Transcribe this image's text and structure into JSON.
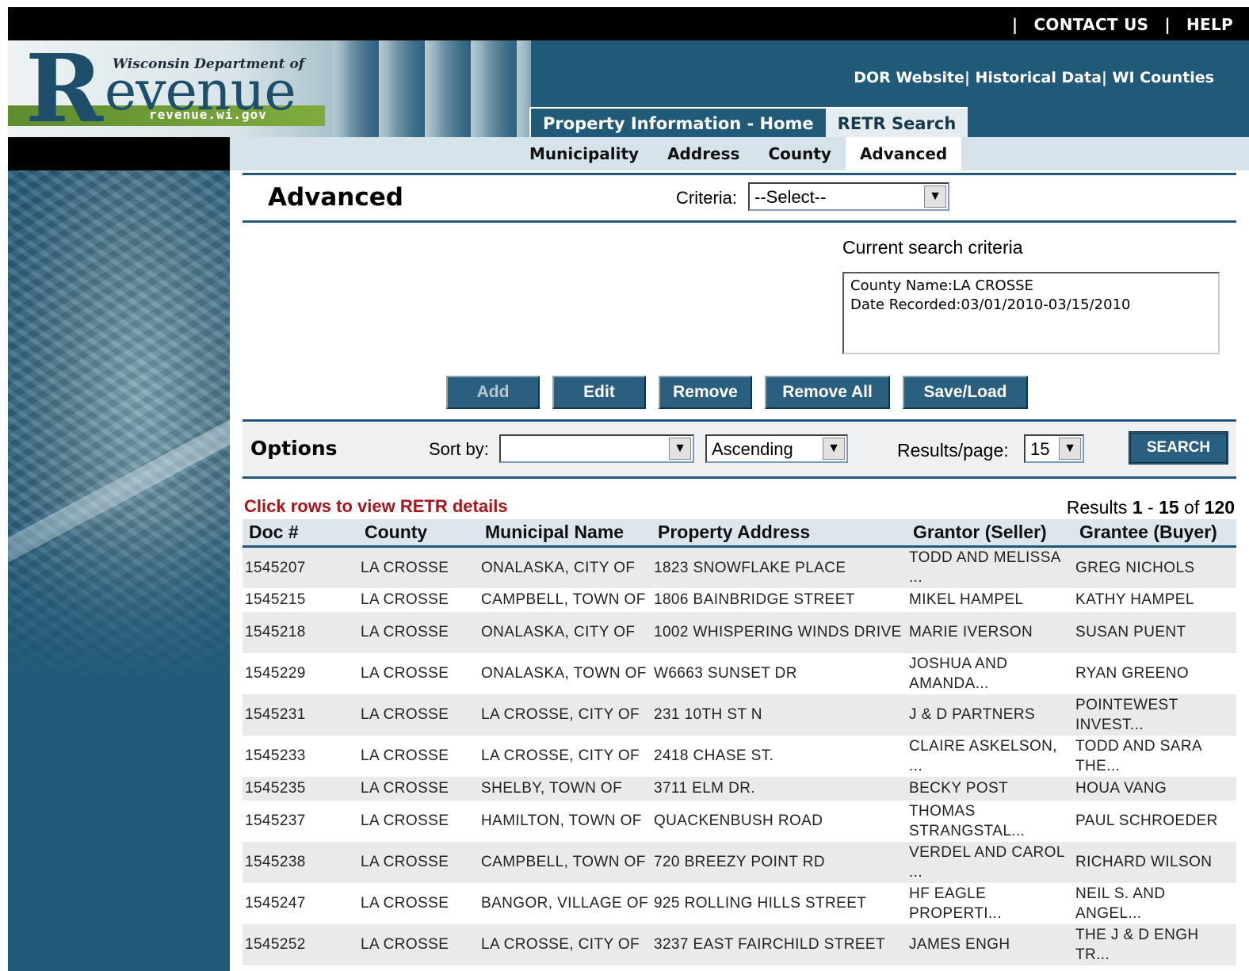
{
  "top_links": {
    "separator": "|",
    "contact": "CONTACT US",
    "help": "HELP"
  },
  "logo": {
    "dept": "Wisconsin Department of",
    "r": "R",
    "word": "evenue",
    "url": "revenue.wi.gov"
  },
  "site_links": "DOR Website| Historical Data| WI Counties",
  "main_tabs": [
    {
      "label": "Property Information - Home"
    },
    {
      "label": "RETR Search"
    }
  ],
  "sub_nav": [
    "Municipality",
    "Address",
    "County",
    "Advanced"
  ],
  "advanced": {
    "title": "Advanced",
    "criteria_label": "Criteria:",
    "criteria_value": "--Select--",
    "current_label": "Current search criteria",
    "current_lines": [
      "County Name:LA CROSSE",
      "Date Recorded:03/01/2010-03/15/2010"
    ]
  },
  "buttons": {
    "add": "Add",
    "edit": "Edit",
    "remove": "Remove",
    "remove_all": "Remove All",
    "save_load": "Save/Load"
  },
  "options": {
    "title": "Options",
    "sort_label": "Sort by:",
    "sort_value": "",
    "order_value": "Ascending",
    "rpp_label": "Results/page:",
    "rpp_value": "15",
    "search_label": "SEARCH"
  },
  "results": {
    "note": "Click rows to view RETR details",
    "prefix": "Results ",
    "from": "1",
    "dash": " - ",
    "to": "15",
    "of": " of ",
    "total": "120"
  },
  "table": {
    "columns": [
      "Doc #",
      "County",
      "Municipal Name",
      "Property Address",
      "Grantor (Seller)",
      "Grantee (Buyer)"
    ],
    "rows": [
      [
        "1545207",
        "LA CROSSE",
        "ONALASKA, CITY OF",
        "1823 SNOWFLAKE PLACE",
        "TODD AND MELISSA ...",
        "GREG NICHOLS"
      ],
      [
        "1545215",
        "LA CROSSE",
        "CAMPBELL, TOWN OF",
        "1806 BAINBRIDGE STREET",
        "MIKEL HAMPEL",
        "KATHY HAMPEL"
      ],
      [
        "1545218",
        "LA CROSSE",
        "ONALASKA, CITY OF",
        "1002 WHISPERING WINDS DRIVE",
        "MARIE IVERSON",
        "SUSAN PUENT"
      ],
      [
        "1545229",
        "LA CROSSE",
        "ONALASKA, TOWN OF",
        "W6663 SUNSET DR",
        "JOSHUA AND AMANDA...",
        "RYAN GREENO"
      ],
      [
        "1545231",
        "LA CROSSE",
        "LA CROSSE, CITY OF",
        "231 10TH ST N",
        "J & D PARTNERS",
        "POINTEWEST INVEST..."
      ],
      [
        "1545233",
        "LA CROSSE",
        "LA CROSSE, CITY OF",
        "2418 CHASE ST.",
        "CLAIRE ASKELSON, ...",
        "TODD AND SARA THE..."
      ],
      [
        "1545235",
        "LA CROSSE",
        "SHELBY, TOWN OF",
        "3711 ELM DR.",
        "BECKY POST",
        "HOUA VANG"
      ],
      [
        "1545237",
        "LA CROSSE",
        "HAMILTON, TOWN OF",
        "QUACKENBUSH ROAD",
        "THOMAS STRANGSTAL...",
        "PAUL SCHROEDER"
      ],
      [
        "1545238",
        "LA CROSSE",
        "CAMPBELL, TOWN OF",
        "720 BREEZY POINT RD",
        "VERDEL AND CAROL ...",
        "RICHARD WILSON"
      ],
      [
        "1545247",
        "LA CROSSE",
        "BANGOR, VILLAGE OF",
        "925 ROLLING HILLS STREET",
        "HF EAGLE PROPERTI...",
        "NEIL S. AND ANGEL..."
      ],
      [
        "1545252",
        "LA CROSSE",
        "LA CROSSE, CITY OF",
        "3237 EAST FAIRCHILD STREET",
        "JAMES ENGH",
        "THE J & D ENGH TR..."
      ]
    ]
  }
}
